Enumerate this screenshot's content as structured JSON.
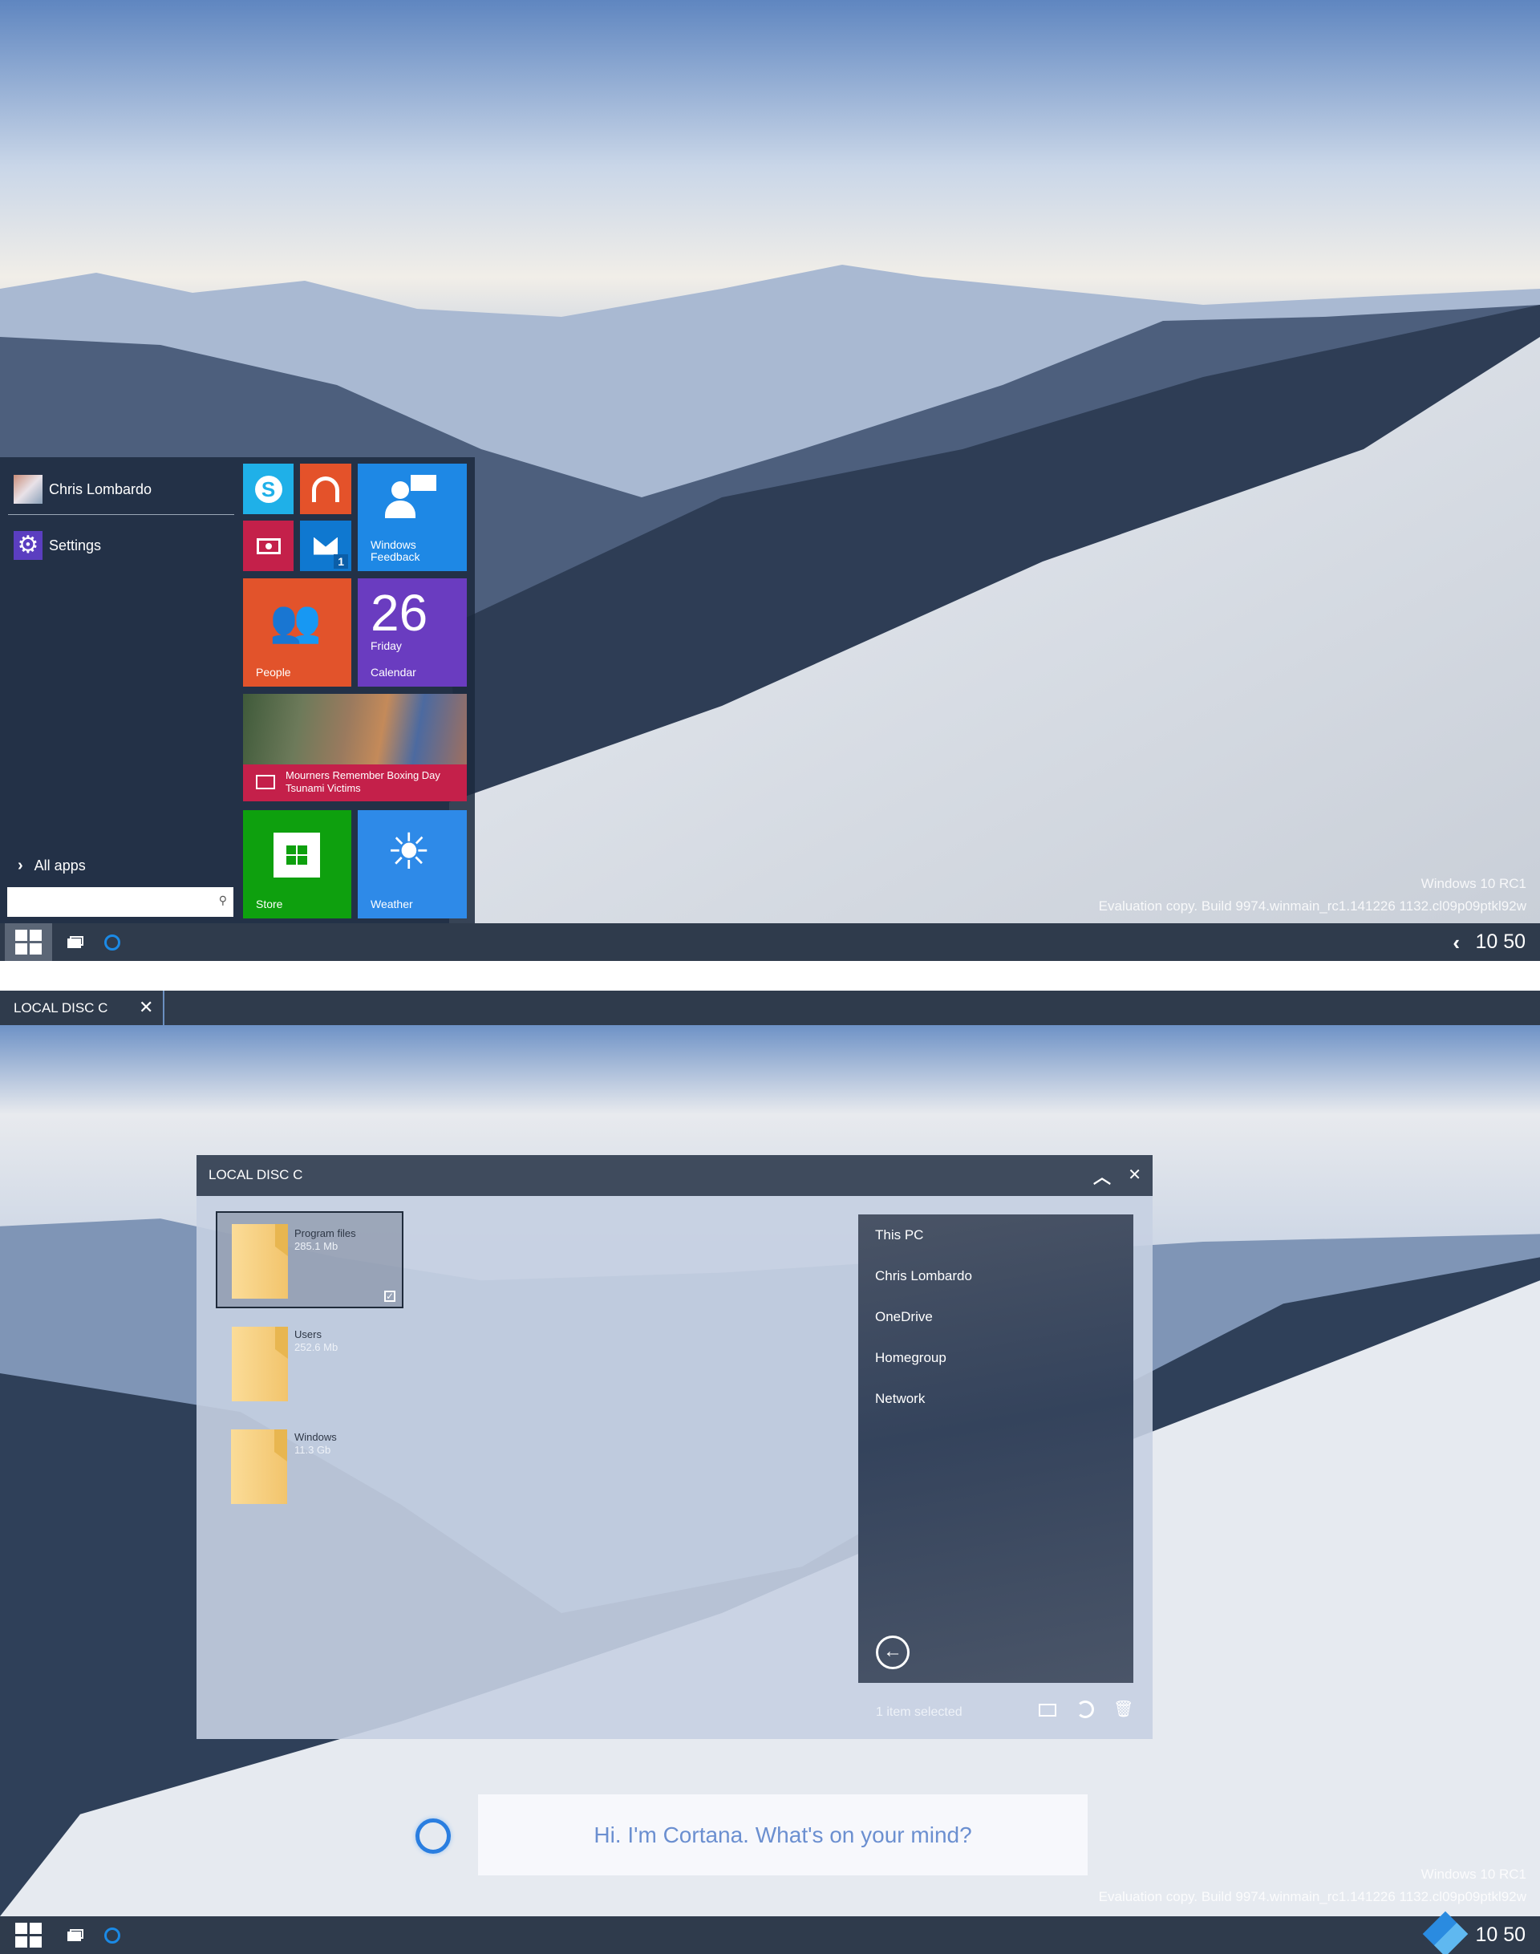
{
  "screen1": {
    "start_menu": {
      "user_name": "Chris Lombardo",
      "settings_label": "Settings",
      "all_apps_label": "All apps",
      "search_value": "",
      "tiles": {
        "skype": {
          "color": "#1fb0e8"
        },
        "music": {
          "color": "#e4522a"
        },
        "video": {
          "color": "#c4204a"
        },
        "mail": {
          "color": "#0f78d0",
          "badge": "1"
        },
        "feedback": {
          "label": "Windows Feedback",
          "color": "#1e88e5"
        },
        "people": {
          "label": "People",
          "color": "#e2532b"
        },
        "calendar": {
          "day_number": "26",
          "weekday": "Friday",
          "label": "Calendar",
          "color": "#6a3cc0"
        },
        "news": {
          "headline": "Mourners Remember Boxing Day Tsunami Victims",
          "color": "#c4204a"
        },
        "store": {
          "label": "Store",
          "color": "#0ea00e"
        },
        "weather": {
          "label": "Weather",
          "color": "#2e8ae8"
        }
      }
    },
    "watermark": {
      "line1": "Windows 10 RC1",
      "line2": "Evaluation copy. Build 9974.winmain_rc1.141226 1132.cl09p09ptkl92w"
    },
    "taskbar": {
      "clock": "10 50"
    }
  },
  "screen2": {
    "tab": {
      "label": "LOCAL DISC C"
    },
    "window": {
      "title": "LOCAL DISC C",
      "items": [
        {
          "name": "Program files",
          "size": "285.1 Mb",
          "selected": true
        },
        {
          "name": "Users",
          "size": "252.6 Mb",
          "selected": false
        },
        {
          "name": "Windows",
          "size": "11.3 Gb",
          "selected": false
        }
      ],
      "nav": [
        "This PC",
        "Chris Lombardo",
        "OneDrive",
        "Homegroup",
        "Network"
      ],
      "status": "1 item selected"
    },
    "cortana": {
      "prompt": "Hi. I'm Cortana. What's on your mind?",
      "accent": "#1b8ae6"
    },
    "watermark": {
      "line1": "Windows 10 RC1",
      "line2": "Evaluation copy. Build 9974.winmain_rc1.141226 1132.cl09p09ptkl92w"
    },
    "taskbar": {
      "clock": "10 50"
    }
  }
}
